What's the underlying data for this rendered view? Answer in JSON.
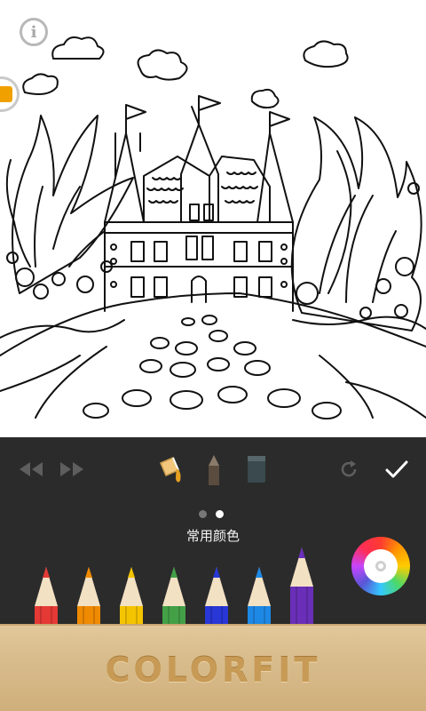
{
  "overlay": {
    "info_glyph": "i"
  },
  "toolbar": {
    "undo_icon": "rewind-icon",
    "redo_icon": "fast-forward-icon",
    "tools": [
      "paint-bucket-icon",
      "pencil-icon",
      "eraser-icon"
    ],
    "refresh_icon": "refresh-icon",
    "confirm_icon": "checkmark-icon"
  },
  "palette": {
    "title": "常用颜色",
    "page_count": 2,
    "active_page": 2,
    "pencils": [
      "#e53935",
      "#f08a00",
      "#f5c400",
      "#43a047",
      "#2837d6",
      "#1e88e5",
      "#6a2fb8"
    ]
  },
  "brand": {
    "name": "COLORFIT"
  }
}
